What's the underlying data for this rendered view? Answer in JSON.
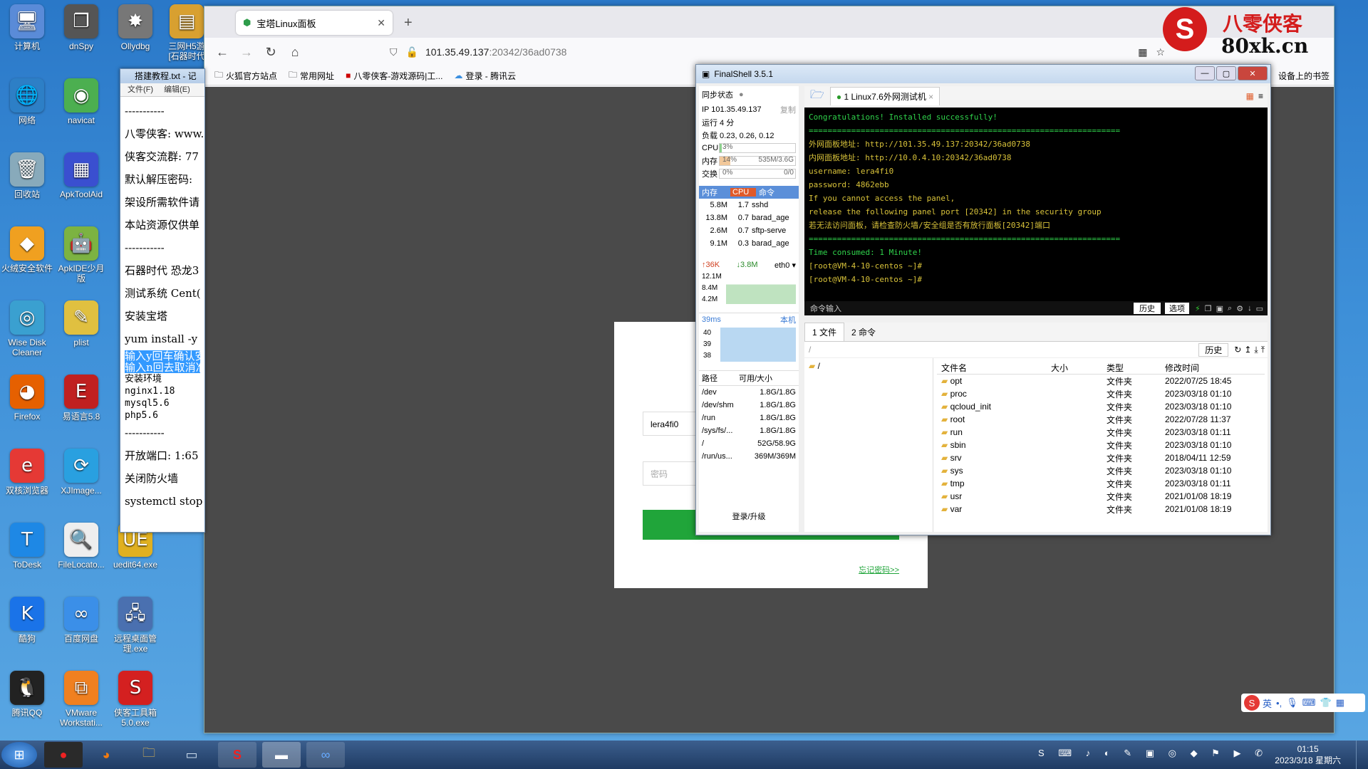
{
  "desktop_icons": [
    {
      "label": "计算机",
      "glyph": "🖥",
      "color": "#5a8bd8"
    },
    {
      "label": "dnSpy",
      "glyph": "❐",
      "color": "#555"
    },
    {
      "label": "Ollydbg",
      "glyph": "✸",
      "color": "#777"
    },
    {
      "label": "三网H5游\n[石器时代",
      "glyph": "▤",
      "color": "#d8a030"
    },
    {
      "label": "网络",
      "glyph": "🌐",
      "color": "#2d7fc6"
    },
    {
      "label": "navicat",
      "glyph": "◉",
      "color": "#4caf50"
    },
    {
      "label": "回收站",
      "glyph": "🗑",
      "color": "#8ab"
    },
    {
      "label": "ApkToolAid",
      "glyph": "▦",
      "color": "#3a4fd0"
    },
    {
      "label": "火绒安全软件",
      "glyph": "◆",
      "color": "#f0a020"
    },
    {
      "label": "ApkIDE少月\n版",
      "glyph": "🤖",
      "color": "#7cb342"
    },
    {
      "label": "Wise Disk\nCleaner",
      "glyph": "◎",
      "color": "#3aa0d0"
    },
    {
      "label": "plist",
      "glyph": "✎",
      "color": "#e0c040"
    },
    {
      "label": "Firefox",
      "glyph": "◕",
      "color": "#e66000"
    },
    {
      "label": "易语言5.8",
      "glyph": "E",
      "color": "#c02020"
    },
    {
      "label": "双核浏览器",
      "glyph": "e",
      "color": "#e53935"
    },
    {
      "label": "XJImage...",
      "glyph": "⟳",
      "color": "#29a0e0"
    },
    {
      "label": "ToDesk",
      "glyph": "T",
      "color": "#1e88e5"
    },
    {
      "label": "FileLocato...",
      "glyph": "🔍",
      "color": "#eee"
    },
    {
      "label": "uedit64.exe",
      "glyph": "UE",
      "color": "#e0b020"
    },
    {
      "label": "酷狗",
      "glyph": "K",
      "color": "#1a73e8"
    },
    {
      "label": "百度网盘",
      "glyph": "∞",
      "color": "#3b8fe8"
    },
    {
      "label": "远程桌面管\n理.exe",
      "glyph": "🖧",
      "color": "#4a70b0"
    },
    {
      "label": "腾讯QQ",
      "glyph": "🐧",
      "color": "#222"
    },
    {
      "label": "VMware\nWorkstati...",
      "glyph": "⧉",
      "color": "#f08020"
    },
    {
      "label": "侠客工具箱\n5.0.exe",
      "glyph": "S",
      "color": "#d42020"
    }
  ],
  "browser": {
    "tab_title": "宝塔Linux面板",
    "url_host": "101.35.49.137",
    "url_path": ":20342/36ad0738",
    "bookmarks": [
      "火狐官方站点",
      "常用网址",
      "八零侠客-游戏源码|工...",
      "登录 - 腾讯云"
    ],
    "bookmarks_right": "设备上的书签",
    "login": {
      "username": "lera4fi0",
      "password_placeholder": "密码",
      "forgot": "忘记密码>>"
    }
  },
  "notepad": {
    "title": "搭建教程.txt - 记",
    "menu": [
      "文件(F)",
      "编辑(E)"
    ],
    "lines": [
      "-----------",
      "八零侠客: www.",
      "侠客交流群: 77",
      "默认解压密码:",
      "架设所需软件请",
      "本站资源仅供单",
      "-----------",
      "石器时代 恐龙3",
      "测试系统 Cent(",
      "安装宝塔",
      "yum install -y",
      "输入y回车确认安",
      "输入n回去取消准",
      "安装环境",
      "nginx1.18",
      "mysql5.6",
      "php5.6",
      "-----------",
      "开放端口: 1:65",
      "关闭防火墙",
      "systemctl stop"
    ]
  },
  "watermark": {
    "brand": "八零侠客",
    "site": "80xk.cn"
  },
  "finalshell": {
    "title": "FinalShell 3.5.1",
    "sync": "同步状态",
    "ip": "IP 101.35.49.137",
    "copy": "复制",
    "uptime": "运行 4 分",
    "load": "负载 0.23, 0.26, 0.12",
    "cpu_label": "CPU",
    "cpu_val": "3%",
    "mem_label": "内存",
    "mem_pct": "14%",
    "mem_val": "535M/3.6G",
    "swap_label": "交换",
    "swap_pct": "0%",
    "swap_val": "0/0",
    "proc_headers": [
      "内存",
      "CPU",
      "命令"
    ],
    "procs": [
      [
        "5.8M",
        "1.7",
        "sshd"
      ],
      [
        "13.8M",
        "0.7",
        "barad_age"
      ],
      [
        "2.6M",
        "0.7",
        "sftp-serve"
      ],
      [
        "9.1M",
        "0.3",
        "barad_age"
      ]
    ],
    "net": {
      "up": "36K",
      "down": "3.8M",
      "iface": "eth0",
      "ticks": [
        "12.1M",
        "8.4M",
        "4.2M"
      ]
    },
    "ping": {
      "ms": "39ms",
      "host": "本机",
      "ticks": [
        "40",
        "39",
        "38"
      ]
    },
    "disk_headers": [
      "路径",
      "可用/大小"
    ],
    "disks": [
      [
        "/dev",
        "1.8G/1.8G"
      ],
      [
        "/dev/shm",
        "1.8G/1.8G"
      ],
      [
        "/run",
        "1.8G/1.8G"
      ],
      [
        "/sys/fs/...",
        "1.8G/1.8G"
      ],
      [
        "/",
        "52G/58.9G"
      ],
      [
        "/run/us...",
        "369M/369M"
      ]
    ],
    "login_upgrade": "登录/升级",
    "session_tab": "1  Linux7.6外网测试机",
    "terminal": [
      {
        "t": "Congratulations! Installed successfully!",
        "c": "g"
      },
      {
        "t": "==================================================================",
        "c": "g"
      },
      {
        "t": "外网面板地址: http://101.35.49.137:20342/36ad0738",
        "c": "y"
      },
      {
        "t": "内网面板地址: http://10.0.4.10:20342/36ad0738",
        "c": "y"
      },
      {
        "t": "username: lera4fi0",
        "c": "y"
      },
      {
        "t": "password: 4862ebb",
        "c": "y"
      },
      {
        "t": "If you cannot access the panel,",
        "c": "y"
      },
      {
        "t": "release the following panel port [20342] in the security group",
        "c": "y"
      },
      {
        "t": "若无法访问面板，请检查防火墙/安全组是否有放行面板[20342]端口",
        "c": "y"
      },
      {
        "t": "==================================================================",
        "c": "g"
      },
      {
        "t": "Time consumed: 1 Minute!",
        "c": "g"
      },
      {
        "t": "[root@VM-4-10-centos ~]#",
        "c": "y"
      },
      {
        "t": "[root@VM-4-10-centos ~]#",
        "c": "y"
      }
    ],
    "cmd_input": "命令输入",
    "history_btn": "历史",
    "options_btn": "选项",
    "file_tabs": [
      "1 文件",
      "2 命令"
    ],
    "path": "/",
    "tree_root": "/",
    "file_history": "历史",
    "file_headers": [
      "文件名",
      "大小",
      "类型",
      "修改时间"
    ],
    "files": [
      [
        "opt",
        "",
        "文件夹",
        "2022/07/25 18:45"
      ],
      [
        "proc",
        "",
        "文件夹",
        "2023/03/18 01:10"
      ],
      [
        "qcloud_init",
        "",
        "文件夹",
        "2023/03/18 01:10"
      ],
      [
        "root",
        "",
        "文件夹",
        "2022/07/28 11:37"
      ],
      [
        "run",
        "",
        "文件夹",
        "2023/03/18 01:11"
      ],
      [
        "sbin",
        "",
        "文件夹",
        "2023/03/18 01:10"
      ],
      [
        "srv",
        "",
        "文件夹",
        "2018/04/11 12:59"
      ],
      [
        "sys",
        "",
        "文件夹",
        "2023/03/18 01:10"
      ],
      [
        "tmp",
        "",
        "文件夹",
        "2023/03/18 01:11"
      ],
      [
        "usr",
        "",
        "文件夹",
        "2021/01/08 18:19"
      ],
      [
        "var",
        "",
        "文件夹",
        "2021/01/08 18:19"
      ]
    ]
  },
  "ime": {
    "lang": "英"
  },
  "clock": {
    "time": "01:15",
    "date": "2023/3/18 星期六"
  }
}
